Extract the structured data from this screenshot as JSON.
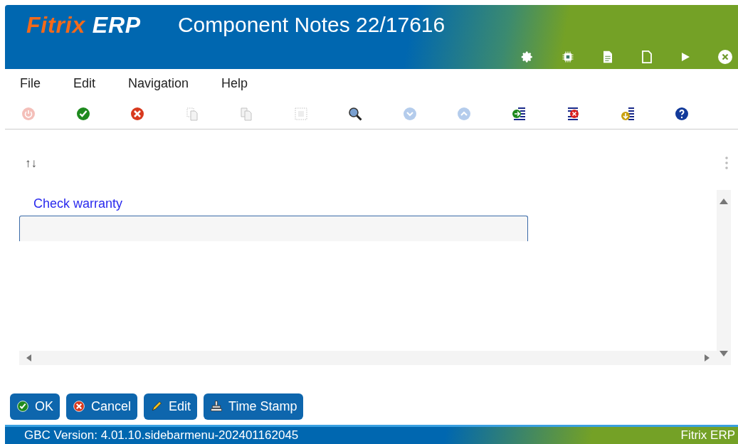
{
  "header": {
    "logo": "Fitrix",
    "logo_suffix": "ERP",
    "title": "Component Notes 22/17616",
    "actions": [
      {
        "kind": "settings"
      },
      {
        "kind": "chip"
      },
      {
        "kind": "document"
      },
      {
        "kind": "blank"
      },
      {
        "kind": "play"
      },
      {
        "kind": "close"
      }
    ]
  },
  "menu": [
    "File",
    "Edit",
    "Navigation",
    "Help"
  ],
  "toolbar": [
    {
      "kind": "power",
      "disabled": true
    },
    {
      "kind": "accept",
      "disabled": false
    },
    {
      "kind": "cancel",
      "disabled": false
    },
    {
      "kind": "copy",
      "disabled": true
    },
    {
      "kind": "paste",
      "disabled": true
    },
    {
      "kind": "select",
      "disabled": true
    },
    {
      "kind": "zoom",
      "disabled": false
    },
    {
      "kind": "down",
      "disabled": true
    },
    {
      "kind": "up",
      "disabled": true
    },
    {
      "kind": "insert",
      "disabled": false
    },
    {
      "kind": "delete",
      "disabled": false
    },
    {
      "kind": "append",
      "disabled": false
    },
    {
      "kind": "help",
      "disabled": false
    }
  ],
  "form": {
    "sort_icon": "↑↓",
    "field_label": "Check warranty"
  },
  "buttons": [
    {
      "kind": "ok",
      "label": "OK"
    },
    {
      "kind": "cancel",
      "label": "Cancel"
    },
    {
      "kind": "edit",
      "label": "Edit"
    },
    {
      "kind": "stamp",
      "label": "Time Stamp"
    }
  ],
  "status_bar": {
    "version": "GBC Version: 4.01.10.sidebarmenu-202401162045",
    "product": "Fitrix ERP"
  }
}
